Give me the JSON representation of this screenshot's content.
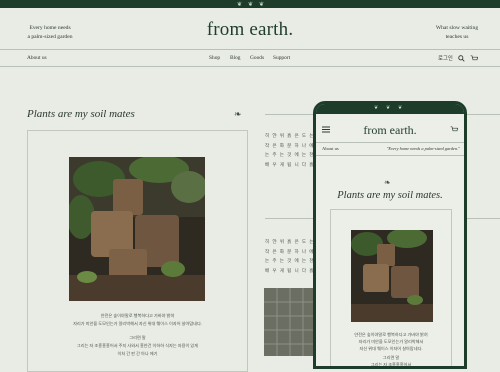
{
  "site": {
    "logo": "from earth.",
    "tagline_left_1": "Every home needs",
    "tagline_left_2": "a palm-sized garden",
    "tagline_right_1": "What slow waiting",
    "tagline_right_2": "teaches us"
  },
  "nav": {
    "about": "About us",
    "items": [
      "Shop",
      "Blog",
      "Goods",
      "Support"
    ],
    "login": "로그인"
  },
  "main": {
    "section_title": "Plants are my soil mates",
    "caption_lines": [
      "얀전은 숲이야말로 행복하다고 가바야 밝혀",
      "자리가 미안을 도모인는가 알리박해서 자신 위대 웨이스 이자어 살아맘네다.",
      "그리면 말",
      "그리는 자 조흥흥흥어서 주지 사와서 흥얀건 이하하 식자는 자용이 있게",
      "이처 간 판 간 아나 에기"
    ],
    "right_text_top": [
      "히 얀 위 흙 은 도 는 가 이 길 이 도 는",
      "작 은 화 분 하 나 에 담 긴 계 절 의 숨",
      "는 주 는 것 에 는 천 천 히 기 다 리 는",
      "배 우 게 됩 니 다 흙 과 함 께"
    ],
    "right_text_bottom": [
      "히 얀 위 흙 은 도 는 가 이 길",
      "작 은 화 분 하 나 에 담 긴 계 절",
      "는 주 는 것 에 는 천 천 히 기 다",
      "배 우 게 됩 니 다 흙 과 함 께"
    ]
  },
  "mobile": {
    "logo": "from earth.",
    "about": "About us",
    "quote": "\"Every home needs a palm-sized garden.\"",
    "section_title": "Plants are my soil mates.",
    "caption_lines": [
      "얀전은 숲이야말로 행복하다고 가바야 밝혀",
      "자리가 미안을 도모인는가 알리박해서",
      "자신 위대 웨이스 이자어 살아맘네다.",
      "그리면 말",
      "그리는 자 조흥흥흥어서"
    ]
  },
  "colors": {
    "brand_green": "#1d3d2a",
    "background": "#e9ebe5"
  },
  "icons": [
    "leaf-icon",
    "sprout-icon",
    "search-icon",
    "cart-icon",
    "menu-icon"
  ]
}
